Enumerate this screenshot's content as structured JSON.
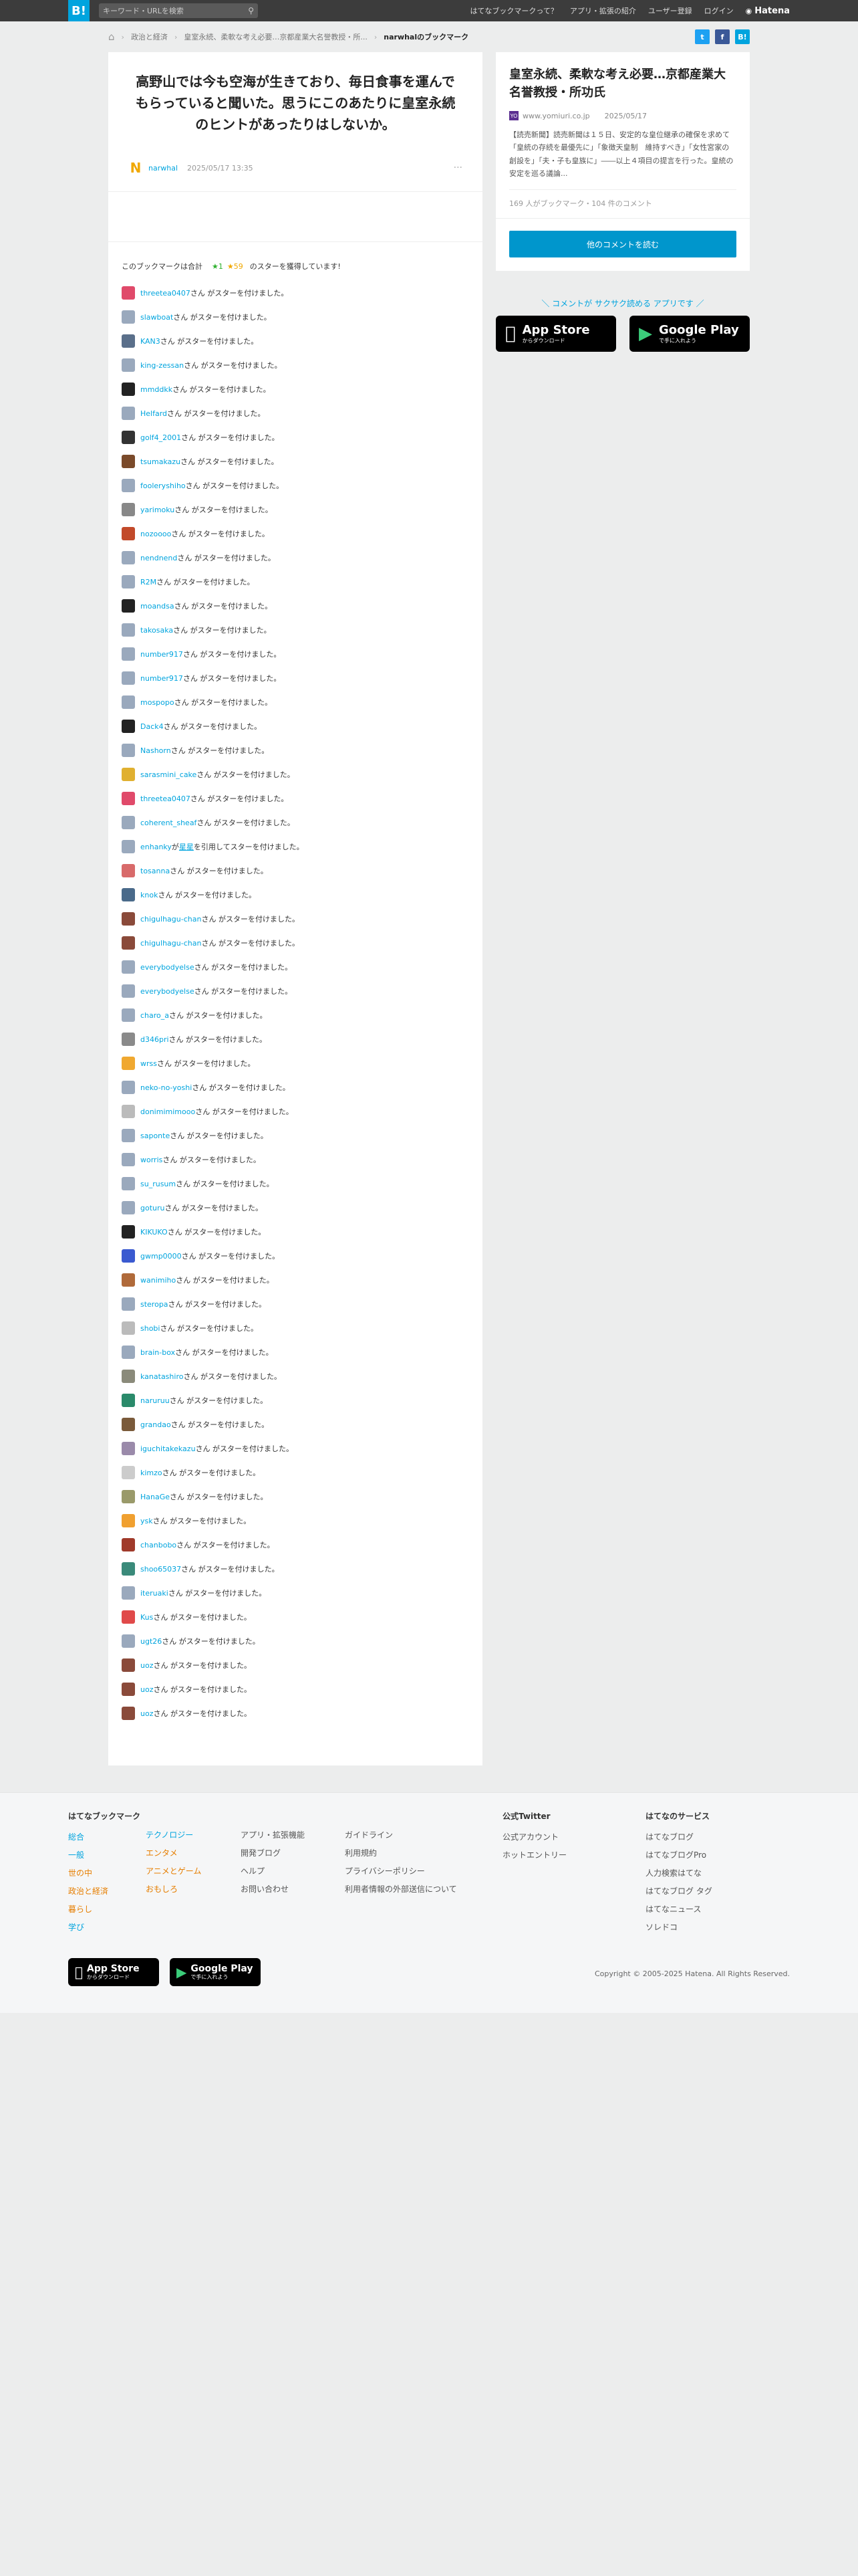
{
  "header": {
    "logo": "B!",
    "search_placeholder": "キーワード・URLを検索",
    "links": [
      "はてなブックマークって？",
      "アプリ・拡張の紹介",
      "ユーザー登録",
      "ログイン"
    ],
    "brand": "Hatena"
  },
  "breadcrumb": {
    "items": [
      "政治と経済",
      "皇室永続、柔軟な考え必要…京都産業大名誉教授・所..."
    ],
    "current": "narwhalのブックマーク"
  },
  "share": {
    "twitter": "t",
    "facebook": "f",
    "hatebu": "B!"
  },
  "comment": {
    "text": "高野山では今も空海が生きており、毎日食事を運んでもらっていると聞いた。思うにこのあたりに皇室永続のヒントがあったりはしないか。",
    "avatar": "N",
    "user": "narwhal",
    "date": "2025/05/17 13:35",
    "more": "···"
  },
  "stars": {
    "summary_prefix": "このブックマークは合計",
    "green": "★1",
    "yellow": "★59",
    "summary_suffix": "のスターを獲得しています!",
    "suffix": "さん がスターを付けました。",
    "list": [
      {
        "user": "threetea0407",
        "color": "#e04a6a"
      },
      {
        "user": "slawboat",
        "color": "#9aa9bd"
      },
      {
        "user": "KAN3",
        "color": "#5a6f8a"
      },
      {
        "user": "king-zessan",
        "color": "#9aa9bd"
      },
      {
        "user": "mmddkk",
        "color": "#222222"
      },
      {
        "user": "Helfard",
        "color": "#9aa9bd"
      },
      {
        "user": "golf4_2001",
        "color": "#333333"
      },
      {
        "user": "tsumakazu",
        "color": "#7a4a2a"
      },
      {
        "user": "fooleryshiho",
        "color": "#9aa9bd"
      },
      {
        "user": "yarimoku",
        "color": "#888888"
      },
      {
        "user": "nozoooo",
        "color": "#c24a2a"
      },
      {
        "user": "nendnend",
        "color": "#9aa9bd"
      },
      {
        "user": "R2M",
        "color": "#9aa9bd"
      },
      {
        "user": "moandsa",
        "color": "#222222"
      },
      {
        "user": "takosaka",
        "color": "#9aa9bd"
      },
      {
        "user": "number917",
        "color": "#9aa9bd"
      },
      {
        "user": "number917",
        "color": "#9aa9bd"
      },
      {
        "user": "mospopo",
        "color": "#9aa9bd"
      },
      {
        "user": "Dack4",
        "color": "#222222"
      },
      {
        "user": "Nashorn",
        "color": "#9aa9bd"
      },
      {
        "user": "sarasmini_cake",
        "color": "#e0b030"
      },
      {
        "user": "threetea0407",
        "color": "#e04a6a"
      },
      {
        "user": "coherent_sheaf",
        "color": "#9aa9bd"
      },
      {
        "user": "enhanky",
        "color": "#9aa9bd",
        "extra": " が ",
        "ref": "星星",
        "extra2": " を引用してスターを付けました。"
      },
      {
        "user": "tosanna",
        "color": "#d86a6a"
      },
      {
        "user": "knok",
        "color": "#4a6a8a"
      },
      {
        "user": "chigulhagu-chan",
        "color": "#8a4a3a"
      },
      {
        "user": "chigulhagu-chan",
        "color": "#8a4a3a"
      },
      {
        "user": "everybodyelse",
        "color": "#9aa9bd"
      },
      {
        "user": "everybodyelse",
        "color": "#9aa9bd"
      },
      {
        "user": "charo_a",
        "color": "#9aa9bd"
      },
      {
        "user": "d346pri",
        "color": "#8a8a8a"
      },
      {
        "user": "wrss",
        "color": "#f0a830"
      },
      {
        "user": "neko-no-yoshi",
        "color": "#9aa9bd"
      },
      {
        "user": "donimimimooo",
        "color": "#bbbbbb"
      },
      {
        "user": "saponte",
        "color": "#9aa9bd"
      },
      {
        "user": "worris",
        "color": "#9aa9bd"
      },
      {
        "user": "su_rusum",
        "color": "#9aa9bd"
      },
      {
        "user": "goturu",
        "color": "#9aa9bd"
      },
      {
        "user": "KIKUKO",
        "color": "#222222"
      },
      {
        "user": "gwmp0000",
        "color": "#3a5ad0"
      },
      {
        "user": "wanimiho",
        "color": "#b06a3a"
      },
      {
        "user": "steropa",
        "color": "#9aa9bd"
      },
      {
        "user": "shobi",
        "color": "#bbbbbb"
      },
      {
        "user": "brain-box",
        "color": "#9aa9bd"
      },
      {
        "user": "kanatashiro",
        "color": "#8a8a7a"
      },
      {
        "user": "naruruu",
        "color": "#2a8a6a"
      },
      {
        "user": "grandao",
        "color": "#7a5a3a"
      },
      {
        "user": "iguchitakekazu",
        "color": "#9a8aaa"
      },
      {
        "user": "kimzo",
        "color": "#cccccc"
      },
      {
        "user": "HanaGe",
        "color": "#9a9a6a"
      },
      {
        "user": "ysk",
        "color": "#f0a030"
      },
      {
        "user": "chanbobo",
        "color": "#a03a2a"
      },
      {
        "user": "shoo65037",
        "color": "#3a8a7a"
      },
      {
        "user": "iteruaki",
        "color": "#9aa9bd"
      },
      {
        "user": "Kus",
        "color": "#e04a4a"
      },
      {
        "user": "ugt26",
        "color": "#9aa9bd"
      },
      {
        "user": "uoz",
        "color": "#8a4a3a"
      },
      {
        "user": "uoz",
        "color": "#8a4a3a"
      },
      {
        "user": "uoz",
        "color": "#8a4a3a"
      }
    ]
  },
  "entry": {
    "title": "皇室永続、柔軟な考え必要…京都産業大名誉教授・所功氏",
    "favicon": "YO",
    "source": "www.yomiuri.co.jp",
    "date": "2025/05/17",
    "summary": "【読売新聞】読売新聞は１５日、安定的な皇位継承の確保を求めて「皇統の存続を最優先に」「象徴天皇制　維持すべき」「女性宮家の創設を」「夫・子も皇族に」――以上４項目の提言を行った。皇統の安定を巡る議論...",
    "counts": "169 人がブックマーク・104 件のコメント",
    "read_button": "他のコメントを読む"
  },
  "promo": "＼ コメントが サクサク読める アプリです ／",
  "appstore": {
    "big": "App Store",
    "small": "からダウンロード"
  },
  "googleplay": {
    "big": "Google Play",
    "small": "で手に入れよう"
  },
  "footer": {
    "col1_title": "はてなブックマーク",
    "cats_a": [
      {
        "label": "総合",
        "color": "blue"
      },
      {
        "label": "一般",
        "color": "blue"
      },
      {
        "label": "世の中",
        "color": "orange"
      },
      {
        "label": "政治と経済",
        "color": "orange"
      },
      {
        "label": "暮らし",
        "color": "orange"
      },
      {
        "label": "学び",
        "color": "blue"
      }
    ],
    "cats_b": [
      {
        "label": "テクノロジー",
        "color": "blue"
      },
      {
        "label": "エンタメ",
        "color": "orange"
      },
      {
        "label": "アニメとゲーム",
        "color": "orange"
      },
      {
        "label": "おもしろ",
        "color": "orange"
      }
    ],
    "links_c": [
      "アプリ・拡張機能",
      "開発ブログ",
      "ヘルプ",
      "お問い合わせ"
    ],
    "links_d": [
      "ガイドライン",
      "利用規約",
      "プライバシーポリシー",
      "利用者情報の外部送信について"
    ],
    "col5_title": "公式Twitter",
    "links_e": [
      "公式アカウント",
      "ホットエントリー"
    ],
    "col6_title": "はてなのサービス",
    "links_f": [
      "はてなブログ",
      "はてなブログPro",
      "人力検索はてな",
      "はてなブログ タグ",
      "はてなニュース",
      "ソレドコ"
    ],
    "copyright": "Copyright © 2005-2025 Hatena. All Rights Reserved."
  }
}
